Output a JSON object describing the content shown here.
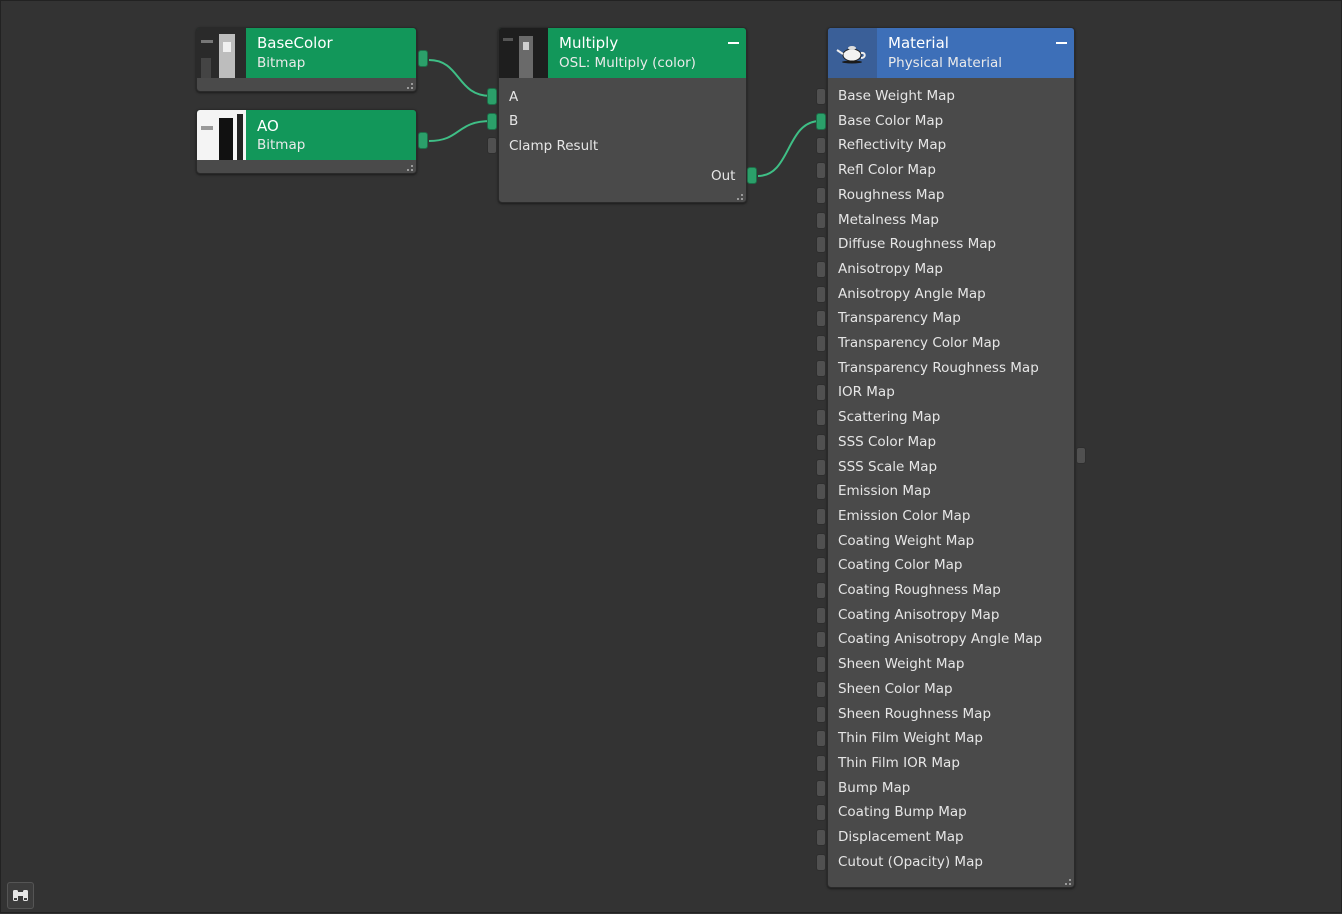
{
  "colors": {
    "canvas_bg": "#333333",
    "node_body": "#4a4a4a",
    "map_header": "#12975a",
    "material_header": "#3d6fb8",
    "wire": "#3fbf86",
    "port_connected": "#2ba06a"
  },
  "nodes": {
    "basecolor": {
      "title": "BaseColor",
      "subtitle": "Bitmap"
    },
    "ao": {
      "title": "AO",
      "subtitle": "Bitmap"
    },
    "multiply": {
      "title": "Multiply",
      "subtitle": "OSL: Multiply (color)",
      "inputs": [
        "A",
        "B",
        "Clamp Result"
      ],
      "output": "Out"
    },
    "material": {
      "title": "Material",
      "subtitle": "Physical Material",
      "icon": "teapot-icon",
      "inputs": [
        "Base Weight Map",
        "Base Color Map",
        "Reflectivity Map",
        "Refl Color Map",
        "Roughness Map",
        "Metalness Map",
        "Diffuse Roughness Map",
        "Anisotropy Map",
        "Anisotropy Angle Map",
        "Transparency Map",
        "Transparency Color Map",
        "Transparency Roughness Map",
        "IOR Map",
        "Scattering Map",
        "SSS Color Map",
        "SSS Scale Map",
        "Emission Map",
        "Emission Color Map",
        "Coating Weight Map",
        "Coating Color Map",
        "Coating Roughness Map",
        "Coating Anisotropy Map",
        "Coating Anisotropy Angle Map",
        "Sheen Weight Map",
        "Sheen Color Map",
        "Sheen Roughness Map",
        "Thin Film Weight Map",
        "Thin Film IOR Map",
        "Bump Map",
        "Coating Bump Map",
        "Displacement Map",
        "Cutout (Opacity) Map"
      ],
      "connected_input": "Base Color Map"
    }
  },
  "toolbar": {
    "search_icon": "binoculars-icon"
  }
}
